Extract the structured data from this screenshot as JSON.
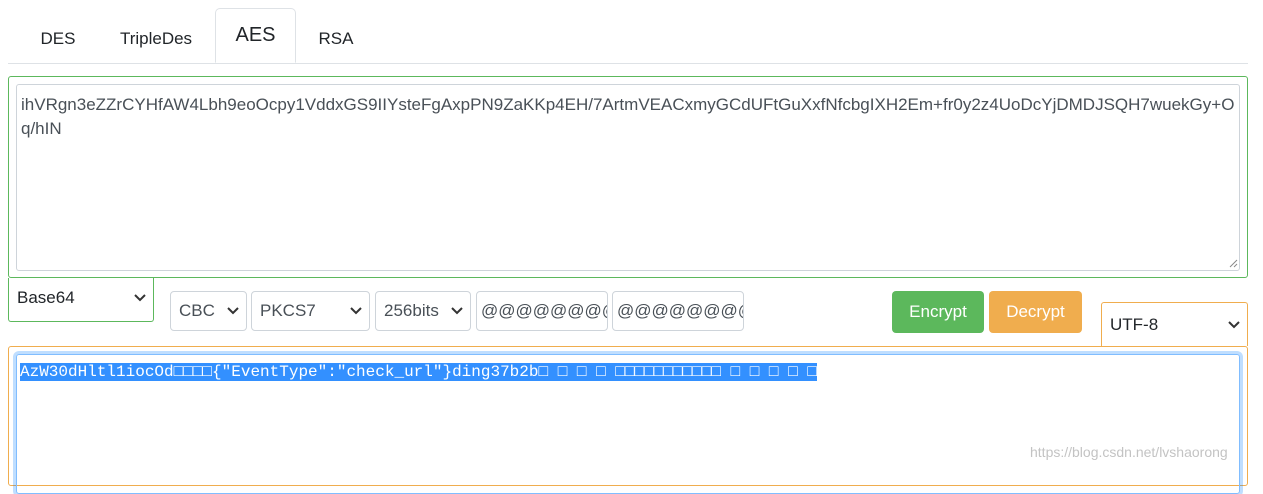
{
  "tabs": [
    {
      "label": "DES",
      "active": false
    },
    {
      "label": "TripleDes",
      "active": false
    },
    {
      "label": "AES",
      "active": true
    },
    {
      "label": "RSA",
      "active": false
    }
  ],
  "input": {
    "value": "ihVRgn3eZZrCYHfAW4Lbh9eoOcpy1VddxGS9IIYsteFgAxpPN9ZaKKp4EH/7ArtmVEACxmyGCdUFtGuXxfNfcbgIXH2Em+fr0y2z4UoDcYjDMDJSQH7wuekGy+Oq/hIN"
  },
  "controls": {
    "encoding": "Base64",
    "mode": "CBC",
    "padding": "PKCS7",
    "key_size": "256bits",
    "key_field": "@@@@@@@@",
    "iv_field": "@@@@@@@@",
    "encrypt_label": "Encrypt",
    "decrypt_label": "Decrypt",
    "charset": "UTF-8"
  },
  "output": {
    "value": "AzW30dHltl1iocOd□□□□{\"EventType\":\"check_url\"}ding37b2b□ □ □ □ □□□□□□□□□□□ □ □ □ □ □"
  },
  "colors": {
    "success": "#5cb85c",
    "warning": "#f0ad4e",
    "selection": "#3390ff"
  },
  "watermark": "https://blog.csdn.net/lvshaorong"
}
